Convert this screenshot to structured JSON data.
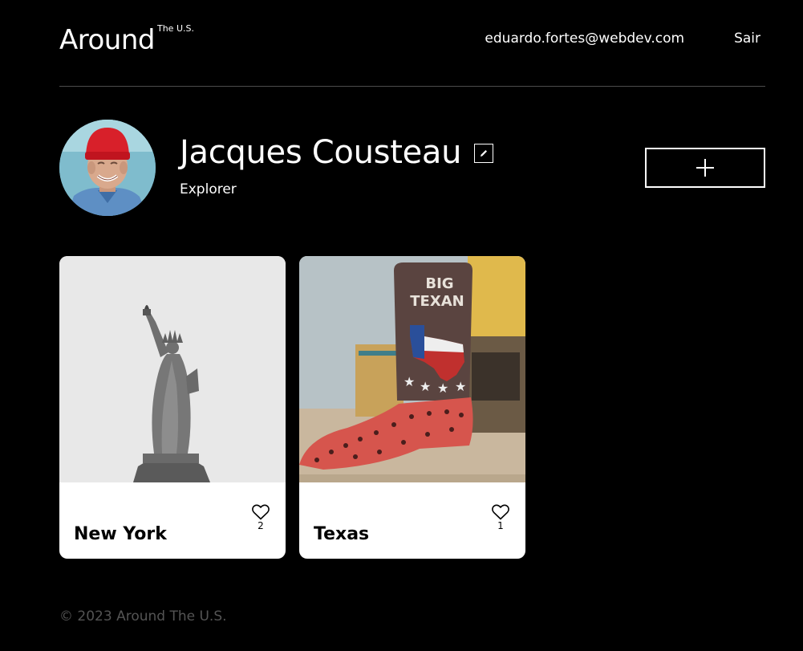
{
  "header": {
    "logo": "Around",
    "logo_sup": "The U.S.",
    "user_email": "eduardo.fortes@webdev.com",
    "logout_label": "Sair"
  },
  "profile": {
    "name": "Jacques Cousteau",
    "role": "Explorer",
    "edit_icon": "pencil-icon",
    "add_icon": "plus-icon"
  },
  "cards": [
    {
      "title": "New York",
      "likes": "2",
      "image": "statue-of-liberty"
    },
    {
      "title": "Texas",
      "likes": "1",
      "image": "big-texan-boot"
    }
  ],
  "footer": {
    "copyright": "© 2023 Around The U.S."
  },
  "colors": {
    "background": "#000000",
    "divider": "#545454",
    "footer_text": "#545454",
    "card_bg": "#ffffff"
  }
}
